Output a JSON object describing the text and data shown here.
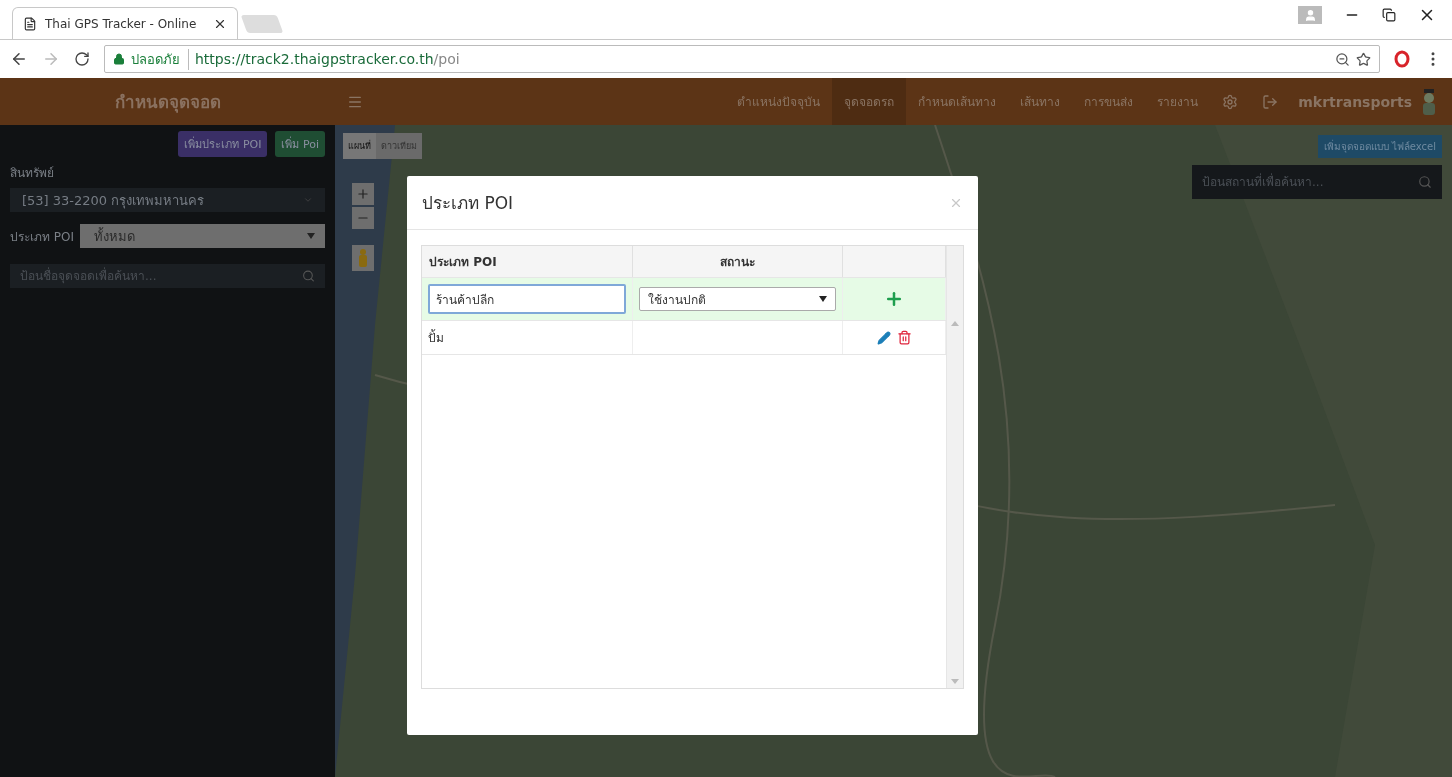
{
  "browser": {
    "tab_title": "Thai GPS Tracker - Online",
    "security_label": "ปลอดภัย",
    "url_host": "https://track2.thaigpstracker.co.th",
    "url_path": "/poi"
  },
  "navbar": {
    "brand": "กำหนดจุดจอด",
    "items": [
      {
        "label": "ตำแหน่งปัจจุบัน",
        "selected": false
      },
      {
        "label": "จุดจอดรถ",
        "selected": true
      },
      {
        "label": "กำหนดเส้นทาง",
        "selected": false
      },
      {
        "label": "เส้นทาง",
        "selected": false
      },
      {
        "label": "การขนส่ง",
        "selected": false
      },
      {
        "label": "รายงาน",
        "selected": false
      }
    ],
    "user": "mkrtransports"
  },
  "sidebar": {
    "buttons": [
      {
        "label": "เพิ่มประเภท POI",
        "color": "#3a2f66"
      },
      {
        "label": "เพิ่ม Poi",
        "color": "#1f4d33"
      }
    ],
    "asset_label": "สินทรัพย์",
    "asset_value": "[53] 33-2200 กรุงเทพมหานคร",
    "poi_type_label": "ประเภท POI",
    "poi_type_value": "ทั้งหมด",
    "search_placeholder": "ป้อนชื่อจุดจอดเพื่อค้นหา..."
  },
  "map": {
    "type_buttons": [
      {
        "label": "แผนที่",
        "selected": true
      },
      {
        "label": "ดาวเทียม",
        "selected": false
      }
    ],
    "excel_button": "เพิ่มจุดจอดแบบ ไฟล์excel",
    "search_placeholder": "ป้อนสถานที่เพื่อค้นหา..."
  },
  "modal": {
    "title": "ประเภท POI",
    "columns": [
      "ประเภท POI",
      "สถานะ"
    ],
    "new_row": {
      "name": "ร้านค้าปลีก",
      "status": "ใช้งานปกติ"
    },
    "rows": [
      {
        "name": "ปั้ม"
      }
    ]
  }
}
